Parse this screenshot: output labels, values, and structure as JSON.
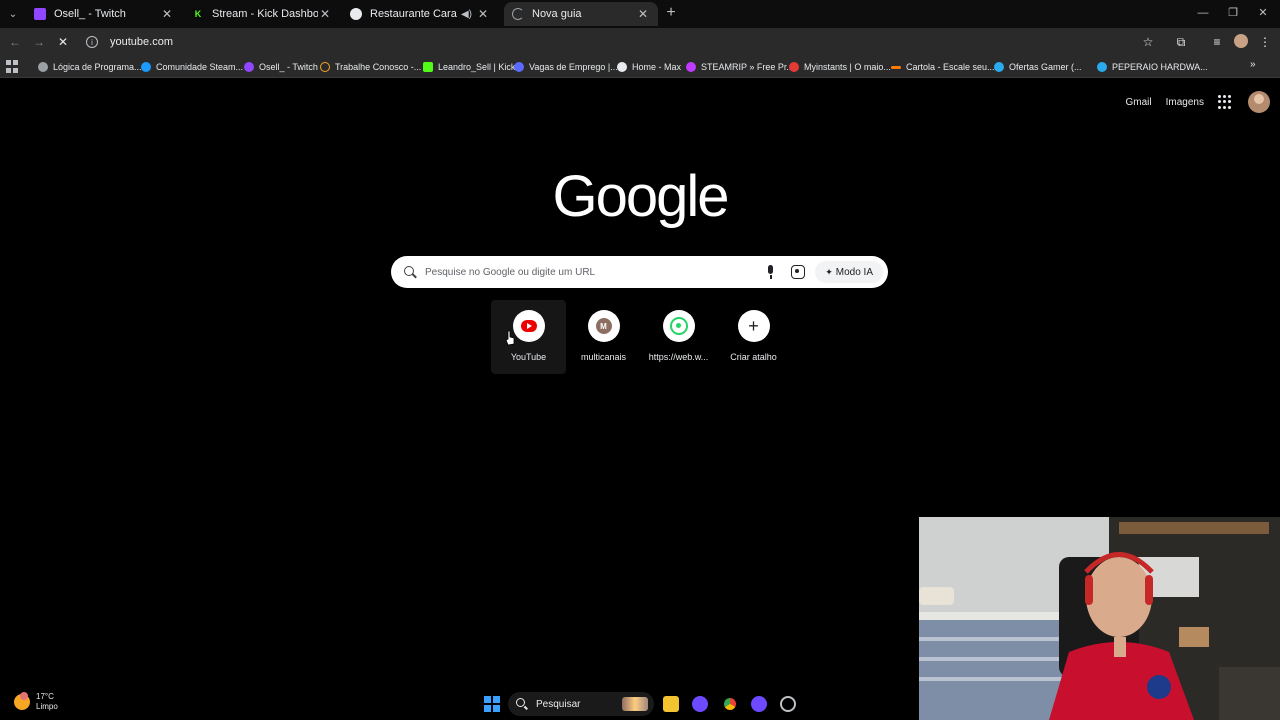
{
  "tabs": [
    {
      "title": "Osell_ - Twitch",
      "favicon": "twitch-icon",
      "color": "#9146ff"
    },
    {
      "title": "Stream - Kick Dashboard",
      "favicon": "kick-icon",
      "color": "#53fc18"
    },
    {
      "title": "Restaurante Caravelas – São",
      "favicon": "website-icon",
      "color": "#e8eaed"
    },
    {
      "title": "Nova guia",
      "favicon": "loading-icon",
      "color": "#e8eaed",
      "active": true
    }
  ],
  "address": "youtube.com",
  "bookmarks": [
    {
      "label": "Lógica de Programa...",
      "color": "#9aa0a6"
    },
    {
      "label": "Comunidade Steam...",
      "color": "#1b9bff"
    },
    {
      "label": "Osell_ - Twitch",
      "color": "#9146ff"
    },
    {
      "label": "Trabalhe Conosco -...",
      "color": "#f5a623"
    },
    {
      "label": "Leandro_Sell | Kick",
      "color": "#53fc18"
    },
    {
      "label": "Vagas de Emprego |...",
      "color": "#5b6bff"
    },
    {
      "label": "Home - Max",
      "color": "#e8eaed"
    },
    {
      "label": "STEAMRIP » Free Pr...",
      "color": "#c13aff"
    },
    {
      "label": "Myinstants | O maio...",
      "color": "#e53935"
    },
    {
      "label": "Cartola - Escale seu...",
      "color": "#ff7a00"
    },
    {
      "label": "Ofertas Gamer (...",
      "color": "#2aabee"
    },
    {
      "label": "PEPERAIO HARDWA...",
      "color": "#2aabee"
    }
  ],
  "ntp": {
    "gmail": "Gmail",
    "images": "Imagens",
    "logo": "Google",
    "search_placeholder": "Pesquise no Google ou digite um URL",
    "ai_mode": "Modo IA",
    "shortcuts": [
      {
        "label": "YouTube",
        "icon": "youtube-icon"
      },
      {
        "label": "multicanais",
        "icon": "m-letter-icon",
        "letter": "M"
      },
      {
        "label": "https://web.w...",
        "icon": "whatsapp-icon"
      },
      {
        "label": "Criar atalho",
        "icon": "plus-icon"
      }
    ]
  },
  "taskbar": {
    "temperature": "17°C",
    "condition": "Limpo",
    "search": "Pesquisar"
  }
}
